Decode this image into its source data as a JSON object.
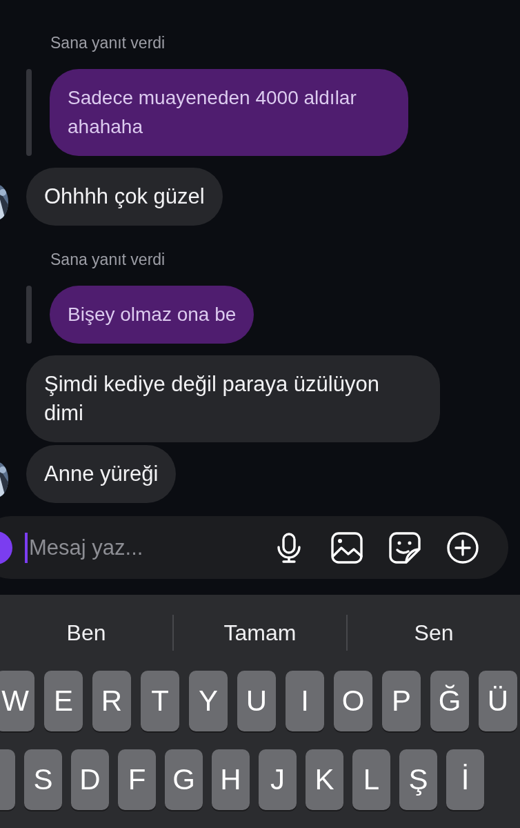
{
  "messages": [
    {
      "kind": "reply",
      "label": "Sana yanıt verdi",
      "text": "Sadece muayeneden 4000 aldılar ahahaha"
    },
    {
      "kind": "incoming",
      "text": "Ohhhh çok güzel",
      "avatar": true
    },
    {
      "kind": "reply",
      "label": "Sana yanıt verdi",
      "text": "Bişey olmaz ona be"
    },
    {
      "kind": "incoming",
      "text": "Şimdi kediye değil paraya üzülüyon dimi",
      "avatar": false
    },
    {
      "kind": "incoming",
      "text": "Anne yüreği",
      "avatar": true
    }
  ],
  "composer": {
    "placeholder": "Mesaj yaz..."
  },
  "suggestions": [
    "Ben",
    "Tamam",
    "Sen"
  ],
  "keyboard": [
    {
      "clipped_key": false,
      "keys": [
        "W",
        "E",
        "R",
        "T",
        "Y",
        "U",
        "I",
        "O",
        "P",
        "Ğ",
        "Ü"
      ]
    },
    {
      "clipped_key": true,
      "keys": [
        "S",
        "D",
        "F",
        "G",
        "H",
        "J",
        "K",
        "L",
        "Ş",
        "İ"
      ]
    }
  ]
}
